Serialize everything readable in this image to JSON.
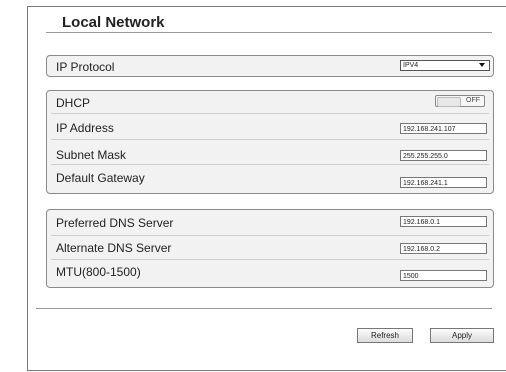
{
  "page": {
    "title": "Local Network"
  },
  "ip_protocol": {
    "label": "IP Protocol",
    "selected": "IPV4"
  },
  "ipv4": {
    "dhcp_label": "DHCP",
    "dhcp_toggle": "OFF",
    "ip_address_label": "IP Address",
    "ip_address_value": "192.168.241.107",
    "subnet_mask_label": "Subnet Mask",
    "subnet_mask_value": "255.255.255.0",
    "gateway_label": "Default Gateway",
    "gateway_value": "192.168.241.1"
  },
  "dns": {
    "preferred_label": "Preferred DNS Server",
    "preferred_value": "192.168.0.1",
    "alternate_label": "Alternate DNS Server",
    "alternate_value": "192.168.0.2",
    "mtu_label": "MTU(800-1500)",
    "mtu_value": "1500"
  },
  "actions": {
    "refresh_label": "Refresh",
    "apply_label": "Apply"
  }
}
